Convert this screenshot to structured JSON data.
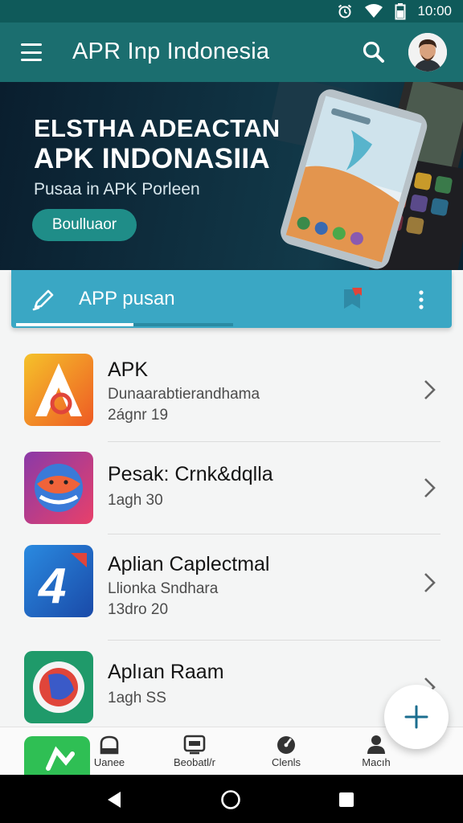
{
  "status_bar": {
    "time": "10:00",
    "icons": [
      "alarm-icon",
      "wifi-icon",
      "battery-icon"
    ]
  },
  "app_bar": {
    "title": "APR Inp Indonesia",
    "icons": [
      "menu-icon",
      "search-icon",
      "avatar"
    ]
  },
  "banner": {
    "title_line1": "ELSTHA ADEACTAN",
    "title_line2": "APK INDONASIIA",
    "subtitle": "Pusaa in APK Porleen",
    "button_label": "Boulluaor"
  },
  "tab_bar": {
    "label": "APP  pusan",
    "icons": [
      "pencil-icon",
      "bookmark-icon",
      "more-vert-icon"
    ]
  },
  "apps": [
    {
      "title": "APK",
      "subtitle": "Dunaarabtierandhama",
      "meta": "2ágnr 19"
    },
    {
      "title": "Pesak: Crnk&dqlla",
      "subtitle": "",
      "meta": "1agh 30"
    },
    {
      "title": "Aplian Caplectmal",
      "subtitle": "Llionka Sndhara",
      "meta": "13dro 20"
    },
    {
      "title": "Aplıan Raam",
      "subtitle": "",
      "meta": "1agh SS"
    }
  ],
  "bottom_nav": [
    {
      "label": "Uanee",
      "icon": "home-icon"
    },
    {
      "label": "Beobatl/r",
      "icon": "tv-icon"
    },
    {
      "label": "Clenls",
      "icon": "speed-icon"
    },
    {
      "label": "Macıh",
      "icon": "person-icon"
    }
  ],
  "fab": {
    "icon": "plus-icon"
  },
  "colors": {
    "primary": "#1b6e6f",
    "tab": "#3aa7c4",
    "banner": "#0f3040",
    "accent_button": "#1f8d88"
  }
}
